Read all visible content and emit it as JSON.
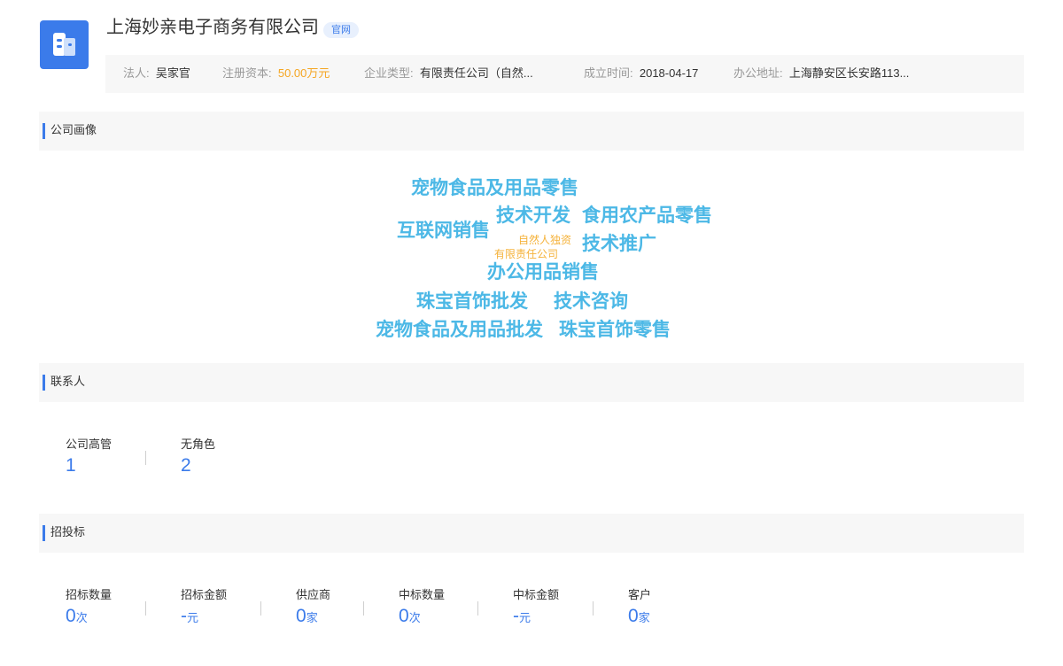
{
  "company": {
    "name": "上海妙亲电子商务有限公司",
    "official_tag": "官网",
    "logo_icon": "building-icon",
    "brand_color": "#3b7bea"
  },
  "info": {
    "legal_rep_label": "法人:",
    "legal_rep": "吴家官",
    "capital_label": "注册资本:",
    "capital": "50.00万元",
    "type_label": "企业类型:",
    "type": "有限责任公司（自然...",
    "founded_label": "成立时间:",
    "founded": "2018-04-17",
    "address_label": "办公地址:",
    "address": "上海静安区长安路113..."
  },
  "profile": {
    "title": "公司画像",
    "words": [
      "宠物食品及用品零售",
      "技术开发",
      "食用农产品零售",
      "互联网销售",
      "自然人独资",
      "有限责任公司",
      "技术推广",
      "办公用品销售",
      "珠宝首饰批发",
      "技术咨询",
      "宠物食品及用品批发",
      "珠宝首饰零售"
    ]
  },
  "contacts": {
    "title": "联系人",
    "stats": [
      {
        "label": "公司高管",
        "value": "1"
      },
      {
        "label": "无角色",
        "value": "2"
      }
    ]
  },
  "bidding": {
    "title": "招投标",
    "stats": [
      {
        "label": "招标数量",
        "value": "0",
        "unit": "次"
      },
      {
        "label": "招标金额",
        "value": "-",
        "unit": "元"
      },
      {
        "label": "供应商",
        "value": "0",
        "unit": "家"
      },
      {
        "label": "中标数量",
        "value": "0",
        "unit": "次"
      },
      {
        "label": "中标金额",
        "value": "-",
        "unit": "元"
      },
      {
        "label": "客户",
        "value": "0",
        "unit": "家"
      }
    ]
  }
}
